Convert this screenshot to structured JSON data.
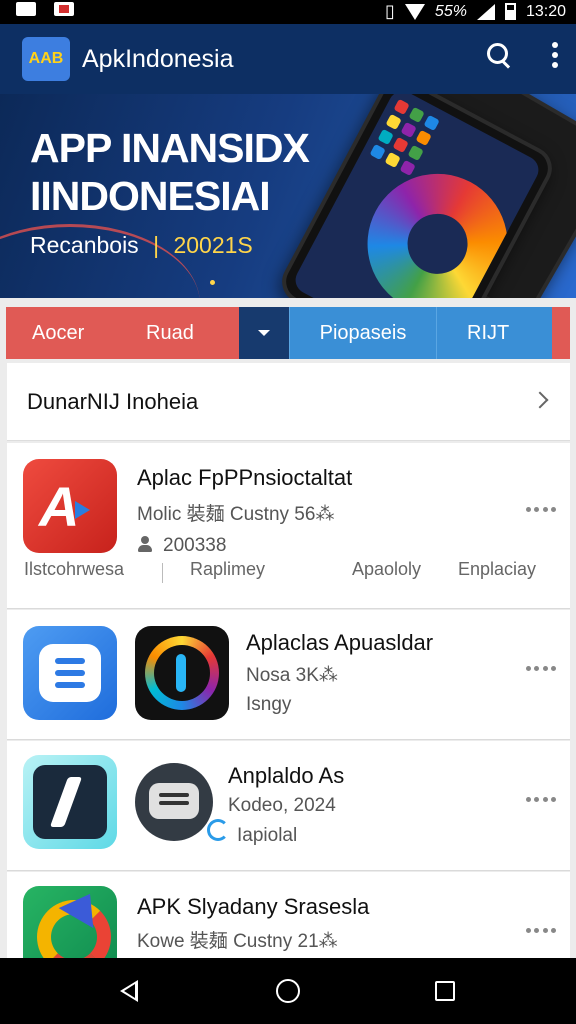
{
  "status_bar": {
    "battery": "55%",
    "time": "13:20"
  },
  "app_bar": {
    "logo_text": "AAB",
    "title": "ApkIndonesia",
    "icons": [
      "search-icon",
      "more-vert-icon"
    ]
  },
  "banner": {
    "title_line1": "APP INANSIDX",
    "title_line2": "IINDONESIAI",
    "subtitle": "Recanbois",
    "separator": "|",
    "year": "20021S"
  },
  "tabs": [
    {
      "label": "Aocer"
    },
    {
      "label": "Ruad"
    },
    {
      "label": ""
    },
    {
      "label": "Piopaseis"
    },
    {
      "label": "RIJT"
    }
  ],
  "section": {
    "title": "DunarNIJ Inoheia"
  },
  "apps": [
    {
      "name": "Aplac FpPPnsioctaltat",
      "meta1": "Molic 裝麺 Custny 56⁂",
      "meta2": "200338",
      "subtabs": [
        "Ilstcohrwesa",
        "Raplimey",
        "Apaololy",
        "Enplaciay"
      ]
    },
    {
      "name": "Aplaclas Apuasldar",
      "meta1": "Nosa 3K⁂",
      "meta2": "Isngy"
    },
    {
      "name": "Anplaldo As",
      "meta1": "Kodeo, 2024",
      "meta2": "Iapiolal"
    },
    {
      "name": "APK Slyadany Srasesla",
      "meta1": "Kowe 裝麺 Custny 21⁂"
    }
  ],
  "colors": {
    "appbar": "#0d2f63",
    "tab_red": "#e05a55",
    "tab_blue": "#3a8fd6",
    "tab_dark": "#173a6e",
    "year_yellow": "#ffd54a"
  }
}
